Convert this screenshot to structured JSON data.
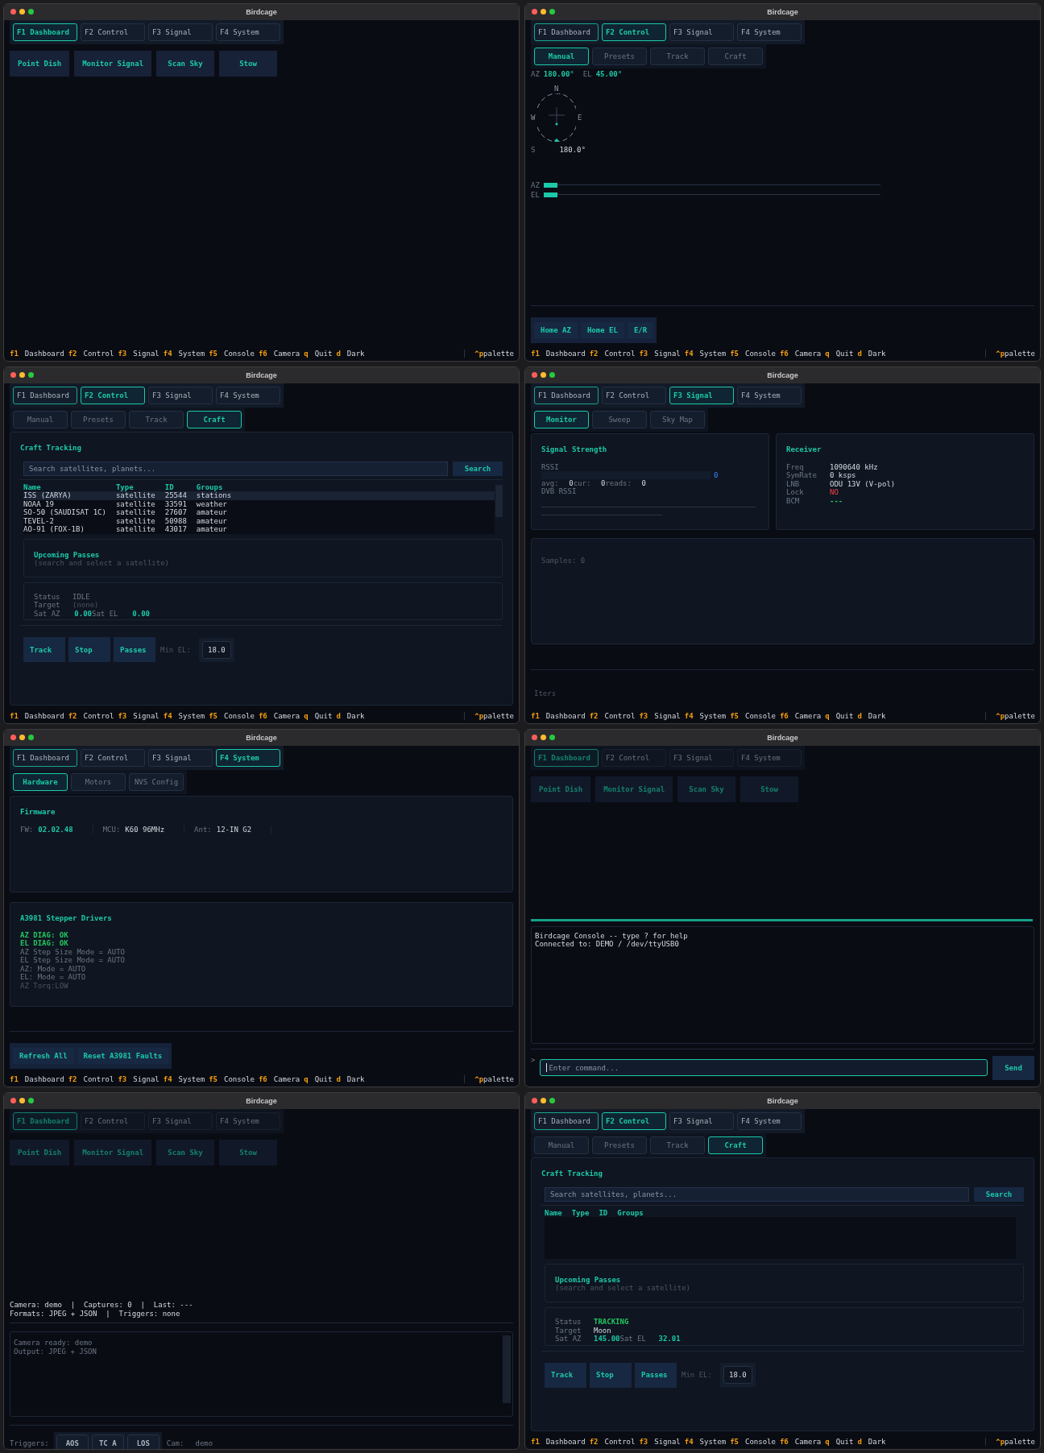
{
  "windows": [
    {
      "title": "Birdcage",
      "faded": false,
      "tabs": [
        {
          "label": "F1 Dashboard",
          "selected": true,
          "focused": false
        },
        {
          "label": "F2 Control",
          "selected": false,
          "focused": false
        },
        {
          "label": "F3 Signal",
          "selected": false,
          "focused": false
        },
        {
          "label": "F4 System",
          "selected": false,
          "focused": false
        }
      ],
      "view": {
        "kind": "dashboard",
        "actions": [
          "Point Dish",
          "Monitor Signal",
          "Scan Sky",
          "Stow"
        ]
      },
      "status_bar": {
        "keys": [
          {
            "key": "f1",
            "label": "Dashboard"
          },
          {
            "key": "f2",
            "label": "Control"
          },
          {
            "key": "f3",
            "label": "Signal"
          },
          {
            "key": "f4",
            "label": "System"
          },
          {
            "key": "f5",
            "label": "Console"
          },
          {
            "key": "f6",
            "label": "Camera"
          },
          {
            "key": "q",
            "label": "Quit"
          },
          {
            "key": "d",
            "label": "Dark"
          }
        ],
        "palette": {
          "key": "^p",
          "label": "palette"
        }
      }
    },
    {
      "title": "Birdcage",
      "faded": false,
      "tabs": [
        {
          "label": "F1 Dashboard",
          "selected": false,
          "focused": true
        },
        {
          "label": "F2 Control",
          "selected": true,
          "focused": false
        },
        {
          "label": "F3 Signal",
          "selected": false,
          "focused": false
        },
        {
          "label": "F4 System",
          "selected": false,
          "focused": false
        }
      ],
      "view": {
        "kind": "manual",
        "subtabs": [
          {
            "label": "Manual",
            "selected": true
          },
          {
            "label": "Presets",
            "selected": false
          },
          {
            "label": "Track",
            "selected": false
          },
          {
            "label": "Craft",
            "selected": false
          }
        ],
        "readout": [
          {
            "label": "AZ",
            "value": "180.00°"
          },
          {
            "label": "EL",
            "value": "45.00°"
          }
        ],
        "compass": {
          "north": "N",
          "west": "W",
          "east": "E",
          "south": "S",
          "heading": "180.0°"
        },
        "axes": [
          {
            "label": "AZ",
            "level": 0.04
          },
          {
            "label": "EL",
            "level": 0.04
          }
        ],
        "actions": [
          "Home AZ",
          "Home EL",
          "E/R"
        ]
      },
      "status_bar": {
        "keys": [
          {
            "key": "f1",
            "label": "Dashboard"
          },
          {
            "key": "f2",
            "label": "Control"
          },
          {
            "key": "f3",
            "label": "Signal"
          },
          {
            "key": "f4",
            "label": "System"
          },
          {
            "key": "f5",
            "label": "Console"
          },
          {
            "key": "f6",
            "label": "Camera"
          },
          {
            "key": "q",
            "label": "Quit"
          },
          {
            "key": "d",
            "label": "Dark"
          }
        ],
        "palette": {
          "key": "^p",
          "label": "palette"
        }
      }
    },
    {
      "title": "Birdcage",
      "faded": false,
      "tabs": [
        {
          "label": "F1 Dashboard",
          "selected": false,
          "focused": true
        },
        {
          "label": "F2 Control",
          "selected": true,
          "focused": false
        },
        {
          "label": "F3 Signal",
          "selected": false,
          "focused": false
        },
        {
          "label": "F4 System",
          "selected": false,
          "focused": false
        }
      ],
      "view": {
        "kind": "craft",
        "subtabs": [
          {
            "label": "Manual",
            "selected": false
          },
          {
            "label": "Presets",
            "selected": false
          },
          {
            "label": "Track",
            "selected": false
          },
          {
            "label": "Craft",
            "selected": true
          }
        ],
        "title": "Craft Tracking",
        "search": {
          "placeholder": "Search satellites, planets...",
          "button": "Search"
        },
        "columns": [
          "Name",
          "Type",
          "ID",
          "Groups"
        ],
        "rows": [
          {
            "cells": [
              "ISS (ZARYA)",
              "satellite",
              "25544",
              "stations"
            ],
            "selected": true
          },
          {
            "cells": [
              "NOAA 19",
              "satellite",
              "33591",
              "weather"
            ],
            "selected": false
          },
          {
            "cells": [
              "SO-50 (SAUDISAT 1C)",
              "satellite",
              "27607",
              "amateur"
            ],
            "selected": false
          },
          {
            "cells": [
              "TEVEL-2",
              "satellite",
              "50988",
              "amateur"
            ],
            "selected": false
          },
          {
            "cells": [
              "AO-91 (FOX-1B)",
              "satellite",
              "43017",
              "amateur"
            ],
            "selected": false
          }
        ],
        "passes": {
          "title": "Upcoming Passes",
          "hint": "(search and select a satellite)"
        },
        "status": [
          {
            "label": "Status",
            "value": "IDLE",
            "kind": "muted"
          },
          {
            "label": "Target",
            "value": "(none)",
            "kind": "dim"
          }
        ],
        "sat": [
          {
            "label": "Sat AZ",
            "value": "0.00"
          },
          {
            "label": "Sat EL",
            "value": "0.00"
          }
        ],
        "actions": [
          "Track",
          "Stop",
          "Passes"
        ],
        "min_el": {
          "label": "Min EL:",
          "value": "18.0"
        }
      },
      "status_bar": {
        "keys": [
          {
            "key": "f1",
            "label": "Dashboard"
          },
          {
            "key": "f2",
            "label": "Control"
          },
          {
            "key": "f3",
            "label": "Signal"
          },
          {
            "key": "f4",
            "label": "System"
          },
          {
            "key": "f5",
            "label": "Console"
          },
          {
            "key": "f6",
            "label": "Camera"
          },
          {
            "key": "q",
            "label": "Quit"
          },
          {
            "key": "d",
            "label": "Dark"
          }
        ],
        "palette": {
          "key": "^p",
          "label": "palette"
        }
      }
    },
    {
      "title": "Birdcage",
      "faded": false,
      "tabs": [
        {
          "label": "F1 Dashboard",
          "selected": false,
          "focused": true
        },
        {
          "label": "F2 Control",
          "selected": false,
          "focused": false
        },
        {
          "label": "F3 Signal",
          "selected": true,
          "focused": false
        },
        {
          "label": "F4 System",
          "selected": false,
          "focused": false
        }
      ],
      "view": {
        "kind": "signal",
        "subtabs": [
          {
            "label": "Monitor",
            "selected": true
          },
          {
            "label": "Sweep",
            "selected": false
          },
          {
            "label": "Sky Map",
            "selected": false
          }
        ],
        "strength": {
          "title": "Signal Strength",
          "label": "RSSI",
          "value": "0",
          "stats": [
            {
              "label": "avg:",
              "value": "0"
            },
            {
              "label": "cur:",
              "value": "0"
            },
            {
              "label": "reads:",
              "value": "0"
            }
          ],
          "dvb": "DVB RSSI"
        },
        "receiver": {
          "title": "Receiver",
          "rows": [
            {
              "label": "Freq",
              "value": "1090640 kHz",
              "kind": "plain"
            },
            {
              "label": "SymRate",
              "value": "0 ksps",
              "kind": "plain"
            },
            {
              "label": "LNB",
              "value": "ODU 13V (V-pol)",
              "kind": "plain"
            },
            {
              "label": "Lock",
              "value": "NO",
              "kind": "alert"
            },
            {
              "label": "BCM",
              "value": "---",
              "kind": "ok"
            }
          ]
        },
        "samples": "Samples: 0",
        "footer": "Iters"
      },
      "status_bar": {
        "keys": [
          {
            "key": "f1",
            "label": "Dashboard"
          },
          {
            "key": "f2",
            "label": "Control"
          },
          {
            "key": "f3",
            "label": "Signal"
          },
          {
            "key": "f4",
            "label": "System"
          },
          {
            "key": "f5",
            "label": "Console"
          },
          {
            "key": "f6",
            "label": "Camera"
          },
          {
            "key": "q",
            "label": "Quit"
          },
          {
            "key": "d",
            "label": "Dark"
          }
        ],
        "palette": {
          "key": "^p",
          "label": "palette"
        }
      }
    },
    {
      "title": "Birdcage",
      "faded": false,
      "tabs": [
        {
          "label": "F1 Dashboard",
          "selected": false,
          "focused": true
        },
        {
          "label": "F2 Control",
          "selected": false,
          "focused": false
        },
        {
          "label": "F3 Signal",
          "selected": false,
          "focused": false
        },
        {
          "label": "F4 System",
          "selected": true,
          "focused": false
        }
      ],
      "view": {
        "kind": "system",
        "subtabs": [
          {
            "label": "Hardware",
            "selected": true
          },
          {
            "label": "Motors",
            "selected": false
          },
          {
            "label": "NVS Config",
            "selected": false
          }
        ],
        "firmware": {
          "title": "Firmware",
          "fields": [
            {
              "label": "FW:",
              "value": "02.02.48",
              "kind": "accent"
            },
            {
              "label": "MCU:",
              "value": "K60 96MHz",
              "kind": "plain"
            },
            {
              "label": "Ant:",
              "value": "12-IN G2",
              "kind": "plain"
            }
          ]
        },
        "drivers": {
          "title": "A3981 Stepper Drivers",
          "lines": [
            {
              "text": "AZ DIAG: OK",
              "kind": "ok"
            },
            {
              "text": "EL DIAG: OK",
              "kind": "ok"
            },
            {
              "text": "AZ Step Size Mode = AUTO",
              "kind": "muted"
            },
            {
              "text": "EL Step Size Mode = AUTO",
              "kind": "muted"
            },
            {
              "text": "AZ: Mode = AUTO",
              "kind": "muted"
            },
            {
              "text": "EL: Mode = AUTO",
              "kind": "muted"
            },
            {
              "text": "AZ Torq:LOW",
              "kind": "dim"
            }
          ]
        },
        "actions": [
          "Refresh All",
          "Reset A3981 Faults"
        ]
      },
      "status_bar": {
        "keys": [
          {
            "key": "f1",
            "label": "Dashboard"
          },
          {
            "key": "f2",
            "label": "Control"
          },
          {
            "key": "f3",
            "label": "Signal"
          },
          {
            "key": "f4",
            "label": "System"
          },
          {
            "key": "f5",
            "label": "Console"
          },
          {
            "key": "f6",
            "label": "Camera"
          },
          {
            "key": "q",
            "label": "Quit"
          },
          {
            "key": "d",
            "label": "Dark"
          }
        ],
        "palette": {
          "key": "^p",
          "label": "palette"
        }
      }
    },
    {
      "title": "Birdcage",
      "faded": true,
      "tabs": [
        {
          "label": "F1 Dashboard",
          "selected": true,
          "focused": false
        },
        {
          "label": "F2 Control",
          "selected": false,
          "focused": false
        },
        {
          "label": "F3 Signal",
          "selected": false,
          "focused": false
        },
        {
          "label": "F4 System",
          "selected": false,
          "focused": false
        }
      ],
      "view": {
        "kind": "dashboard",
        "actions": [
          "Point Dish",
          "Monitor Signal",
          "Scan Sky",
          "Stow"
        ]
      },
      "drawer": {
        "kind": "console",
        "lines": [
          "Birdcage Console -- type ? for help",
          "Connected to: DEMO / /dev/ttyUSB0"
        ],
        "prompt": ">",
        "placeholder": "Enter command...",
        "button": "Send"
      }
    },
    {
      "title": "Birdcage",
      "faded": true,
      "tabs": [
        {
          "label": "F1 Dashboard",
          "selected": true,
          "focused": false
        },
        {
          "label": "F2 Control",
          "selected": false,
          "focused": false
        },
        {
          "label": "F3 Signal",
          "selected": false,
          "focused": false
        },
        {
          "label": "F4 System",
          "selected": false,
          "focused": false
        }
      ],
      "view": {
        "kind": "dashboard",
        "actions": [
          "Point Dish",
          "Monitor Signal",
          "Scan Sky",
          "Stow"
        ]
      },
      "drawer": {
        "kind": "camera",
        "info": [
          "Camera: demo  |  Captures: 0  |  Last: ---",
          "Formats: JPEG + JSON  |  Triggers: none"
        ],
        "log": [
          "Camera ready: demo",
          "Output: JPEG + JSON"
        ],
        "triggers_label": "Triggers:",
        "triggers": [
          "AOS",
          "TC A",
          "LOS"
        ],
        "cam_label": "Cam:",
        "cam": "demo"
      }
    },
    {
      "title": "Birdcage",
      "faded": false,
      "tabs": [
        {
          "label": "F1 Dashboard",
          "selected": false,
          "focused": true
        },
        {
          "label": "F2 Control",
          "selected": true,
          "focused": false
        },
        {
          "label": "F3 Signal",
          "selected": false,
          "focused": false
        },
        {
          "label": "F4 System",
          "selected": false,
          "focused": false
        }
      ],
      "view": {
        "kind": "craft",
        "subtabs": [
          {
            "label": "Manual",
            "selected": false
          },
          {
            "label": "Presets",
            "selected": false
          },
          {
            "label": "Track",
            "selected": false
          },
          {
            "label": "Craft",
            "selected": true
          }
        ],
        "title": "Craft Tracking",
        "search": {
          "placeholder": "Search satellites, planets...",
          "button": "Search"
        },
        "columns": [
          "Name",
          "Type",
          "ID",
          "Groups"
        ],
        "passes": {
          "title": "Upcoming Passes",
          "hint": "(search and select a satellite)"
        },
        "status": [
          {
            "label": "Status",
            "value": "TRACKING",
            "kind": "ok"
          },
          {
            "label": "Target",
            "value": "Moon",
            "kind": "plain"
          }
        ],
        "sat": [
          {
            "label": "Sat AZ",
            "value": "145.00"
          },
          {
            "label": "Sat EL",
            "value": "32.01"
          }
        ],
        "actions": [
          "Track",
          "Stop",
          "Passes"
        ],
        "min_el": {
          "label": "Min EL:",
          "value": "18.0"
        }
      },
      "status_bar": {
        "keys": [
          {
            "key": "f1",
            "label": "Dashboard"
          },
          {
            "key": "f2",
            "label": "Control"
          },
          {
            "key": "f3",
            "label": "Signal"
          },
          {
            "key": "f4",
            "label": "System"
          },
          {
            "key": "f5",
            "label": "Console"
          },
          {
            "key": "f6",
            "label": "Camera"
          },
          {
            "key": "q",
            "label": "Quit"
          },
          {
            "key": "d",
            "label": "Dark"
          }
        ],
        "palette": {
          "key": "^p",
          "label": "palette"
        }
      }
    }
  ]
}
